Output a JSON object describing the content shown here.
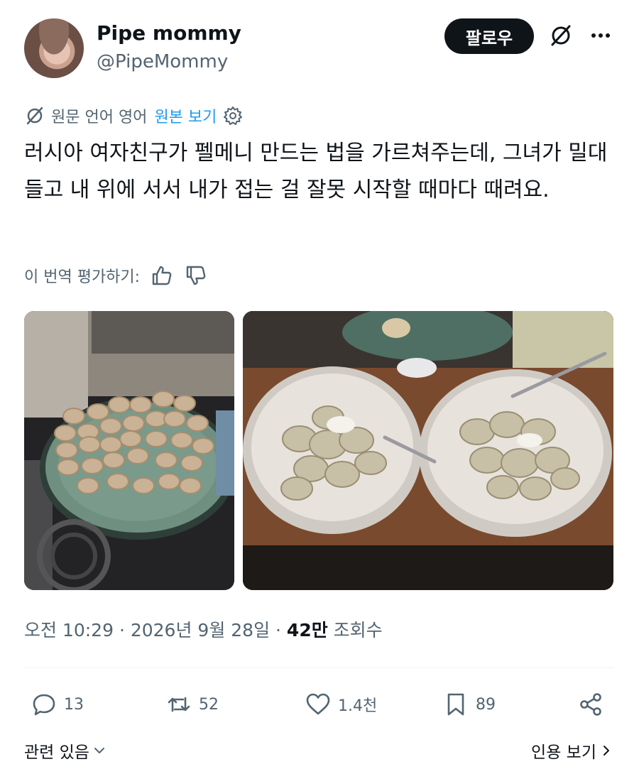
{
  "author": {
    "display_name": "Pipe mommy",
    "handle": "@PipeMommy",
    "avatar_icon": "avatar"
  },
  "header": {
    "follow_label": "팔로우",
    "grok_icon": "grok-icon",
    "more_icon": "more-icon"
  },
  "translation": {
    "source_language_text": "원문 언어 영어",
    "show_original_label": "원본 보기",
    "settings_icon": "gear-icon"
  },
  "tweet": {
    "text": "러시아 여자친구가 펠메니 만드는 법을 가르쳐주는데, 그녀가 밀대 들고 내 위에 서서 내가 접는 걸 잘못 시작할 때마다 때려요."
  },
  "rating": {
    "label": "이 번역 평가하기:"
  },
  "meta": {
    "time": "오전 10:29",
    "separator1": " · ",
    "date": "2026년 9월 28일",
    "separator2": " · ",
    "views_count": "42만",
    "views_label": " 조회수"
  },
  "actions": {
    "replies": "13",
    "reposts": "52",
    "likes": "1.4천",
    "bookmarks": "89"
  },
  "footer": {
    "related_label": "관련 있음",
    "quotes_label": "인용 보기"
  },
  "colors": {
    "accent": "#1d9bf0",
    "text_primary": "#0f1419",
    "text_secondary": "#536471"
  }
}
